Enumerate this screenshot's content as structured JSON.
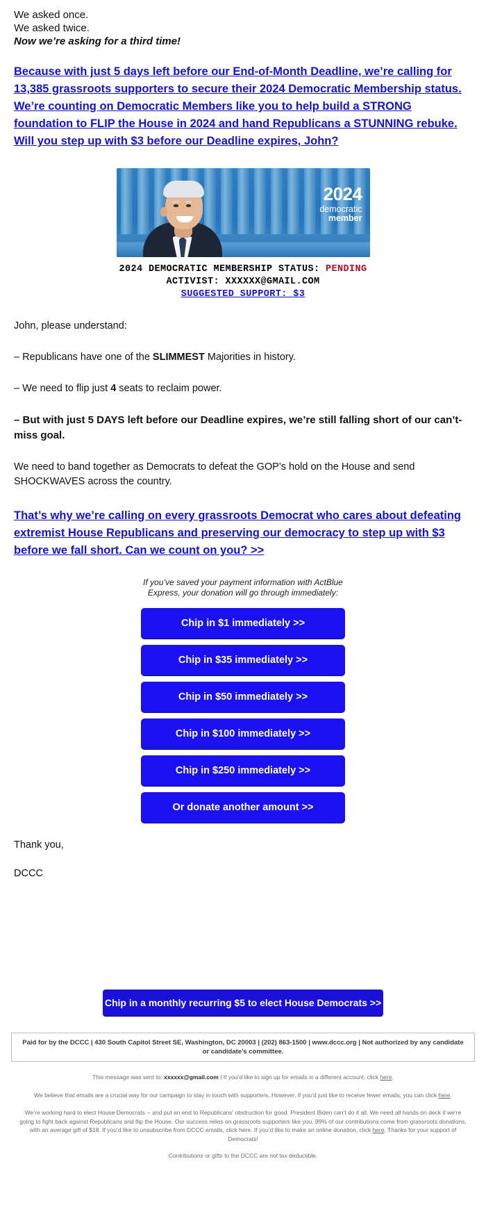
{
  "intro": {
    "line1": "We asked once.",
    "line2": "We asked twice.",
    "line3": "Now we’re asking for a third time!"
  },
  "lead_link": "Because with just 5 days left before our End-of-Month Deadline, we’re calling for 13,385 grassroots supporters to secure their 2024 Democratic Membership status. We’re counting on Democratic Members like you to help build a STRONG foundation to FLIP the House in 2024 and hand Republicans a STUNNING rebuke. Will you step up with $3 before our Deadline expires, John?",
  "hero": {
    "year": "2024",
    "sub1": "democratic",
    "sub2": "member",
    "alt": "President Joe Biden smiling in front of blue capitol columns"
  },
  "status": {
    "label": "2024 DEMOCRATIC MEMBERSHIP STATUS:",
    "value": "PENDING",
    "activist_label": "ACTIVIST:",
    "activist_email": "XXXXXX@GMAIL.COM",
    "suggested": "SUGGESTED SUPPORT: $3",
    "pending_color": "#b01030",
    "link_color": "#1414d2"
  },
  "body": {
    "greeting": "John, please understand:",
    "bullet1_pre": "– Republicans have one of the ",
    "bullet1_bold": "SLIMMEST",
    "bullet1_post": " Majorities in history.",
    "bullet2_pre": "– We need to flip just ",
    "bullet2_bold": "4",
    "bullet2_post": " seats to reclaim power.",
    "bullet3": "– But with just 5 DAYS left before our Deadline expires, we’re still falling short of our can’t-miss goal.",
    "para1": "We need to band together as Democrats to defeat the GOP’s hold on the House and send SHOCKWAVES across the country.",
    "closing_link": "That’s why we’re calling on every grassroots Democrat who cares about defeating extremist House Republicans and preserving our democracy to step up with $3 before we fall short. Can we count on you? >>",
    "thank_you": "Thank you,",
    "signature": "DCCC"
  },
  "actblue_note": "If you’ve saved your payment information with ActBlue Express, your donation will go through immediately:",
  "donate_buttons": [
    {
      "label": "Chip in $1 immediately >>"
    },
    {
      "label": "Chip in $35 immediately >>"
    },
    {
      "label": "Chip in $50 immediately >>"
    },
    {
      "label": "Chip in $100 immediately >>"
    },
    {
      "label": "Chip in $250 immediately >>"
    },
    {
      "label": "Or donate another amount >>"
    }
  ],
  "recurring_button": "Chip in a monthly recurring $5 to elect House Democrats >>",
  "footer": {
    "paid_for": "Paid for by the DCCC | 430 South Capitol Street SE, Washington, DC 20003 | (202) 863-1500 | www.dccc.org | Not authorized by any candidate or candidate’s committee.",
    "sent_pre": "This message was sent to: ",
    "sent_email": "xxxxxx@gmail.com",
    "sent_post": " | If you’d like to sign up for emails in a different account, click ",
    "sent_link": "here",
    "sent_end": ".",
    "fewer_pre": "We believe that emails are a crucial way for our campaign to stay in touch with supporters. However, if you’d just like to receive fewer emails, you can click ",
    "fewer_link": "here",
    "fewer_end": ".",
    "disclaimer_1": "We’re working hard to elect House Democrats -- and put an end to Republicans’ obstruction for good. President Biden can’t do it all. We need all hands on deck if we’re going to fight back against Republicans and flip the House. Our success relies on grassroots supporters like you. 99% of our contributions come from grassroots donations, with an average gift of $18. If you’d like to unsubscribe from DCCC emails, click here. If you’d like to make an online donation, click ",
    "disclaimer_link": "here",
    "disclaimer_2": ". Thanks for your support of Democrats!",
    "tax": "Contributions or gifts to the DCCC are not tax deductible."
  },
  "colors": {
    "button_blue": "#1a10f0",
    "recurring_blue": "#1a10d8",
    "link_blue": "#1414d2",
    "pending_red": "#b01030"
  }
}
